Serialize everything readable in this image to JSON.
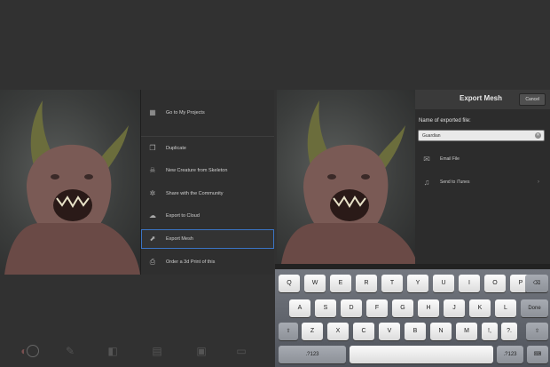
{
  "left_menu": {
    "items": [
      {
        "label": "Go to My Projects",
        "icon": "grid-icon"
      },
      {
        "label": "Duplicate",
        "icon": "duplicate-icon"
      },
      {
        "label": "New Creature from Skeleton",
        "icon": "skeleton-icon"
      },
      {
        "label": "Share with the Community",
        "icon": "share-icon"
      },
      {
        "label": "Export to Cloud",
        "icon": "cloud-icon"
      },
      {
        "label": "Export Mesh",
        "icon": "export-mesh-icon",
        "selected": true
      },
      {
        "label": "Order a 3d Print of this",
        "icon": "print-icon"
      }
    ]
  },
  "export_panel": {
    "title": "Export Mesh",
    "cancel_label": "Cancel",
    "name_label": "Name of exported file:",
    "file_name": "Guardian",
    "options": [
      {
        "label": "Email File",
        "icon": "mail-icon"
      },
      {
        "label": "Send to iTunes",
        "icon": "itunes-icon"
      }
    ]
  },
  "keyboard": {
    "row1": [
      "Q",
      "W",
      "E",
      "R",
      "T",
      "Y",
      "U",
      "I",
      "O",
      "P"
    ],
    "row2": [
      "A",
      "S",
      "D",
      "F",
      "G",
      "H",
      "J",
      "K",
      "L"
    ],
    "row3": [
      "Z",
      "X",
      "C",
      "V",
      "B",
      "N",
      "M",
      "!,",
      "?."
    ],
    "done_label": "Done",
    "numbers_label": ".?123",
    "backspace_icon": "backspace-icon",
    "shift_icon": "shift-icon",
    "hide_keyboard_icon": "keyboard-hide-icon"
  },
  "toolbar": {
    "icons": [
      "color-wheel-icon",
      "brush-icon",
      "camera-icon",
      "layers-icon",
      "photo-icon",
      "folder-icon"
    ]
  },
  "colors": {
    "background": "#313131",
    "menu_background": "#2f2f2f",
    "selection_accent": "#3b74c4",
    "keyboard_background": "#62666e"
  }
}
